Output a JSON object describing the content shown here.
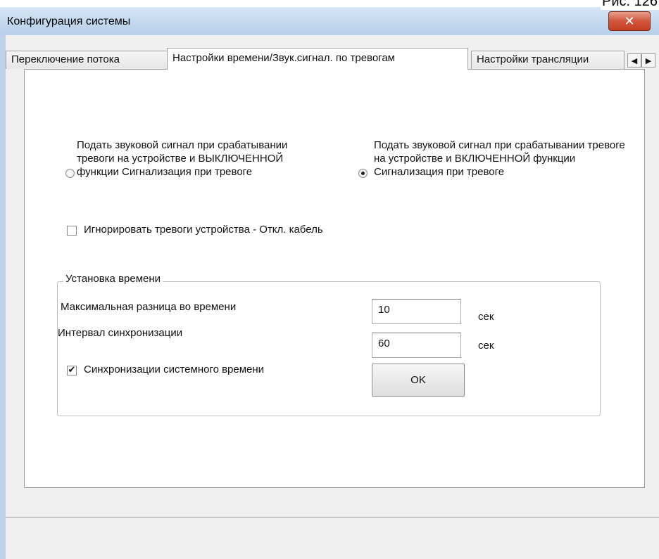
{
  "window": {
    "title": "Конфигурация системы",
    "close_glyph": "✕"
  },
  "tabs": [
    {
      "label": "Переключение потока"
    },
    {
      "label": "Настройки времени/Звук.сигнал. по тревогам",
      "active": true
    },
    {
      "label": "Настройки трансляции"
    }
  ],
  "tab_scroll": {
    "left": "◀",
    "right": "▶"
  },
  "alarm_sound": {
    "option_off": "Подать звуковой сигнал при срабатывании тревоги на устройстве и ВЫКЛЮЧЕННОЙ функции Сигнализация при тревоге",
    "option_on": "Подать звуковой сигнал при срабатывании тревоге на устройстве и ВКЛЮЧЕННОЙ функции Сигнализация при тревоге",
    "selected": "option_on"
  },
  "ignore_cable": {
    "label": "Игнорировать тревоги устройства - Откл. кабель",
    "checked": false
  },
  "time_settings": {
    "legend": "Установка времени",
    "max_diff_label": "Максимальная разница во времени",
    "max_diff_value": "10",
    "max_diff_unit": "сек",
    "sync_interval_label": "Интервал синхронизации",
    "sync_interval_value": "60",
    "sync_interval_unit": "сек",
    "sync_time_label": "Синхронизации системного времени",
    "sync_time_checked": true,
    "checkmark": "✔",
    "ok_label": "OK"
  },
  "figure_caption": "Рис. 126"
}
